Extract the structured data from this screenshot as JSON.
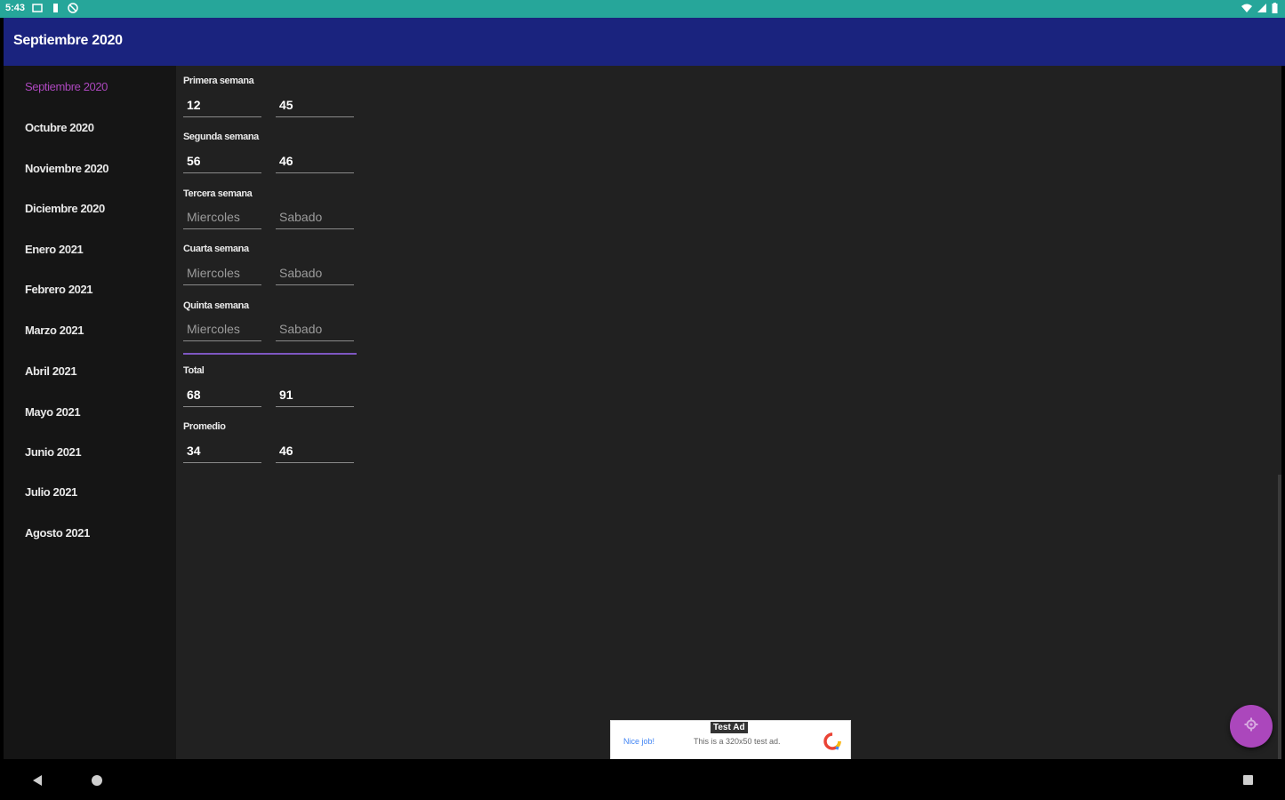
{
  "status_bar": {
    "time": "5:43",
    "icons_left": [
      "notification-icon",
      "battery-saver-icon",
      "sync-icon"
    ],
    "icons_right": [
      "wifi-icon",
      "signal-icon",
      "battery-icon"
    ]
  },
  "app_bar": {
    "title": "Septiembre 2020",
    "color": "#1a237e"
  },
  "sidebar": {
    "items": [
      {
        "label": "Septiembre 2020",
        "active": true
      },
      {
        "label": "Octubre 2020",
        "active": false
      },
      {
        "label": "Noviembre 2020",
        "active": false
      },
      {
        "label": "Diciembre 2020",
        "active": false
      },
      {
        "label": "Enero 2021",
        "active": false
      },
      {
        "label": "Febrero 2021",
        "active": false
      },
      {
        "label": "Marzo 2021",
        "active": false
      },
      {
        "label": "Abril 2021",
        "active": false
      },
      {
        "label": "Mayo 2021",
        "active": false
      },
      {
        "label": "Junio 2021",
        "active": false
      },
      {
        "label": "Julio 2021",
        "active": false
      },
      {
        "label": "Agosto 2021",
        "active": false
      }
    ],
    "active_color": "#ab47bc"
  },
  "weeks": [
    {
      "label": "Primera semana",
      "value1": "12",
      "value2": "45",
      "placeholder1": "",
      "placeholder2": ""
    },
    {
      "label": "Segunda semana",
      "value1": "56",
      "value2": "46",
      "placeholder1": "",
      "placeholder2": ""
    },
    {
      "label": "Tercera semana",
      "value1": "",
      "value2": "",
      "placeholder1": "Miercoles",
      "placeholder2": "Sabado"
    },
    {
      "label": "Cuarta semana",
      "value1": "",
      "value2": "",
      "placeholder1": "Miercoles",
      "placeholder2": "Sabado"
    },
    {
      "label": "Quinta semana",
      "value1": "",
      "value2": "",
      "placeholder1": "Miercoles",
      "placeholder2": "Sabado"
    }
  ],
  "total": {
    "label": "Total",
    "value1": "68",
    "value2": "91"
  },
  "promedio": {
    "label": "Promedio",
    "value1": "34",
    "value2": "46"
  },
  "fab": {
    "icon": "gear-icon",
    "color": "#ab47bc"
  },
  "ad": {
    "tag": "Test Ad",
    "nice_job": "Nice job!",
    "text": "This is a 320x50 test ad.",
    "logo": "google-ad-logo-icon"
  },
  "nav_bar": {
    "icons": [
      "back-icon",
      "home-icon",
      "recents-icon"
    ]
  }
}
